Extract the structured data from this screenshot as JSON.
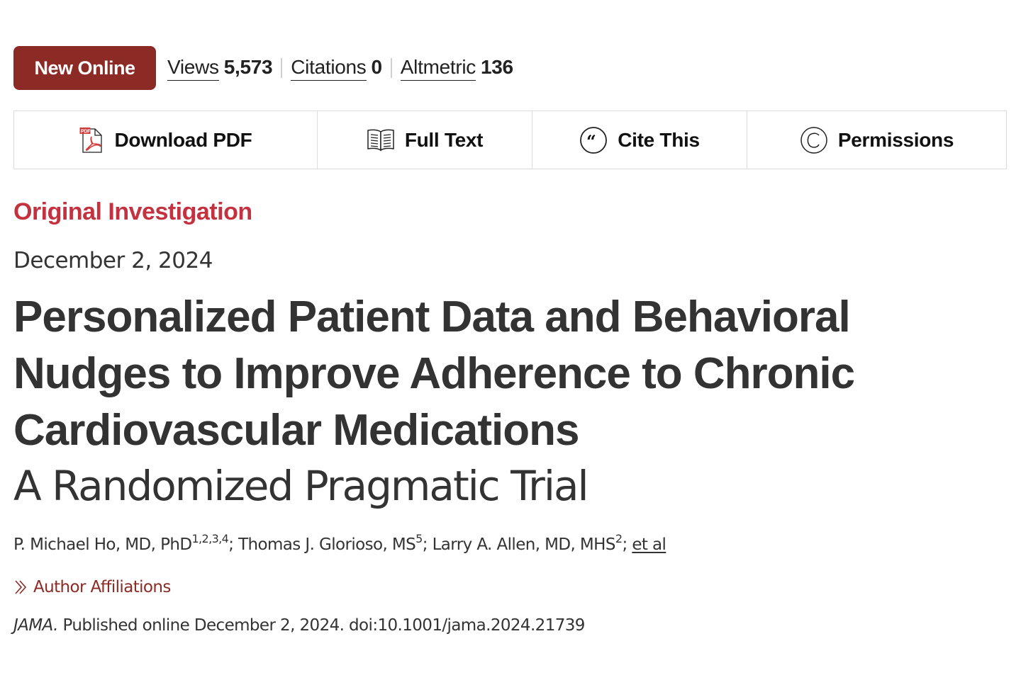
{
  "badge": {
    "label": "New Online",
    "color": "#8c2a25"
  },
  "metrics": [
    {
      "label": "Views",
      "value": "5,573"
    },
    {
      "label": "Citations",
      "value": "0"
    },
    {
      "label": "Altmetric",
      "value": "136"
    }
  ],
  "toolbar": {
    "download_pdf": {
      "label": "Download PDF",
      "icon": "pdf-file-icon"
    },
    "full_text": {
      "label": "Full Text",
      "icon": "open-book-icon"
    },
    "cite_this": {
      "label": "Cite This",
      "icon": "quote-icon"
    },
    "permissions": {
      "label": "Permissions",
      "icon": "copyright-icon"
    }
  },
  "article": {
    "type": "Original Investigation",
    "type_color": "#c4313f",
    "date": "December 2, 2024",
    "title": "Personalized Patient Data and Behavioral Nudges to Improve Adherence to Chronic Cardiovascular Medications",
    "subtitle": "A Randomized Pragmatic Trial",
    "authors": [
      {
        "name": "P. Michael Ho, MD, PhD",
        "affiliations": "1,2,3,4"
      },
      {
        "name": "Thomas J. Glorioso, MS",
        "affiliations": "5"
      },
      {
        "name": "Larry A. Allen, MD, MHS",
        "affiliations": "2"
      }
    ],
    "et_al_label": "et al",
    "separator": "; ",
    "affiliations_label": "Author Affiliations",
    "affiliations_color": "#8c2a25",
    "citation": {
      "journal": "JAMA.",
      "text": " Published online December 2, 2024. doi:10.1001/jama.2024.21739"
    }
  }
}
